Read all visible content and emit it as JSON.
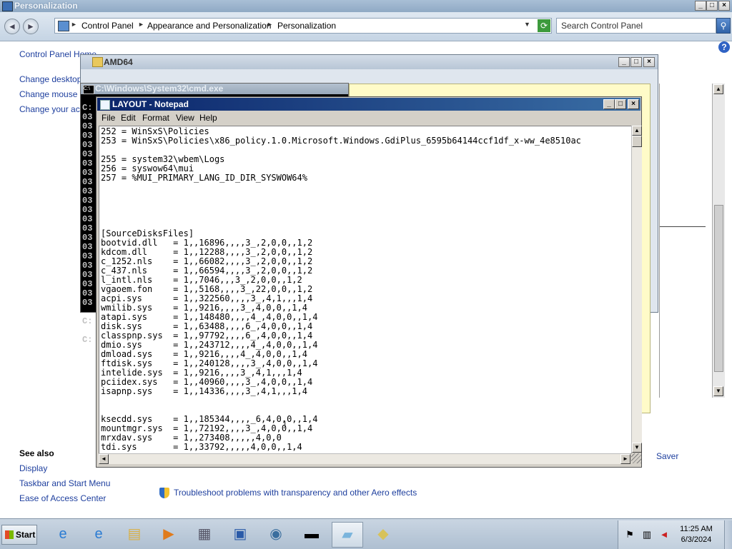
{
  "control_panel": {
    "title": "Personalization",
    "breadcrumb": [
      "Control Panel",
      "Appearance and Personalization",
      "Personalization"
    ],
    "search_placeholder": "Search Control Panel",
    "sidebar_links": [
      "Control Panel Home",
      "Change desktop ic",
      "Change mouse po",
      "Change your acc"
    ],
    "see_also_heading": "See also",
    "see_also_links": [
      "Display",
      "Taskbar and Start Menu",
      "Ease of Access Center"
    ],
    "troubleshoot_link": "Troubleshoot problems with transparency and other Aero effects",
    "partial_label_saver": "Saver"
  },
  "explorer": {
    "title": "AMD64"
  },
  "cmd": {
    "title": "C:\\Windows\\System32\\cmd.exe",
    "line_prefixes": [
      "C:",
      "03",
      "03",
      "03",
      "03",
      "03",
      "03",
      "03",
      "03",
      "03",
      "03",
      "03",
      "03",
      "03",
      "03",
      "03",
      "03",
      "03",
      "03",
      "03",
      "03",
      "03",
      "",
      "C:",
      "",
      "C:"
    ]
  },
  "notepad": {
    "title": "LAYOUT - Notepad",
    "menu": [
      "File",
      "Edit",
      "Format",
      "View",
      "Help"
    ],
    "lines": [
      "252 = WinSxS\\Policies",
      "253 = WinSxS\\Policies\\x86_policy.1.0.Microsoft.Windows.GdiPlus_6595b64144ccf1df_x-ww_4e8510ac",
      "",
      "255 = system32\\wbem\\Logs",
      "256 = syswow64\\mui",
      "257 = %MUI_PRIMARY_LANG_ID_DIR_SYSWOW64%",
      "",
      "",
      "",
      "",
      "",
      "[SourceDisksFiles]",
      "bootvid.dll   = 1,,16896,,,,3_,2,0,0,,1,2",
      "kdcom.dll     = 1,,12288,,,,3_,2,0,0,,1,2",
      "c_1252.nls    = 1,,66082,,,,3_,2,0,0,,1,2",
      "c_437.nls     = 1,,66594,,,,3_,2,0,0,,1,2",
      "l_intl.nls    = 1,,7046,,,3_,2,0,0,,1,2",
      "vgaoem.fon    = 1,,5168,,,,3_,22,0,0,,1,2",
      "acpi.sys      = 1,,322560,,,,3_,4,1,,,1,4",
      "wmilib.sys    = 1,,9216,,,,3_,4,0,0,,1,4",
      "atapi.sys     = 1,,148480,,,,4_,4,0,0,,1,4",
      "disk.sys      = 1,,63488,,,,6_,4,0,0,,1,4",
      "classpnp.sys  = 1,,97792,,,,6_,4,0,0,,1,4",
      "dmio.sys      = 1,,243712,,,,4_,4,0,0,,1,4",
      "dmload.sys    = 1,,9216,,,,4_,4,0,0,,1,4",
      "ftdisk.sys    = 1,,240128,,,,3_,4,0,0,,1,4",
      "intelide.sys  = 1,,9216,,,,3_,4,1,,,1,4",
      "pciidex.sys   = 1,,40960,,,,3_,4,0,0,,1,4",
      "isapnp.sys    = 1,,14336,,,,3_,4,1,,,1,4",
      "",
      "",
      "ksecdd.sys    = 1,,185344,,,,_6,4,0,0,,1,4",
      "mountmgr.sys  = 1,,72192,,,,3_,4,0,0,,1,4",
      "mrxdav.sys    = 1,,273408,,,,,4,0,0",
      "tdi.sys       = 1,,33792,,,,,4,0,0,,1,4"
    ]
  },
  "taskbar": {
    "start_label": "Start",
    "clock_time": "11:25 AM",
    "clock_date": "6/3/2024"
  },
  "icons": {
    "caption_min": "_",
    "caption_max": "□",
    "caption_close": "×",
    "nav_back": "◄",
    "nav_forward": "►",
    "dropdown": "▼",
    "scroll_up": "▲",
    "scroll_down": "▼",
    "scroll_left": "◄",
    "scroll_right": "►"
  }
}
